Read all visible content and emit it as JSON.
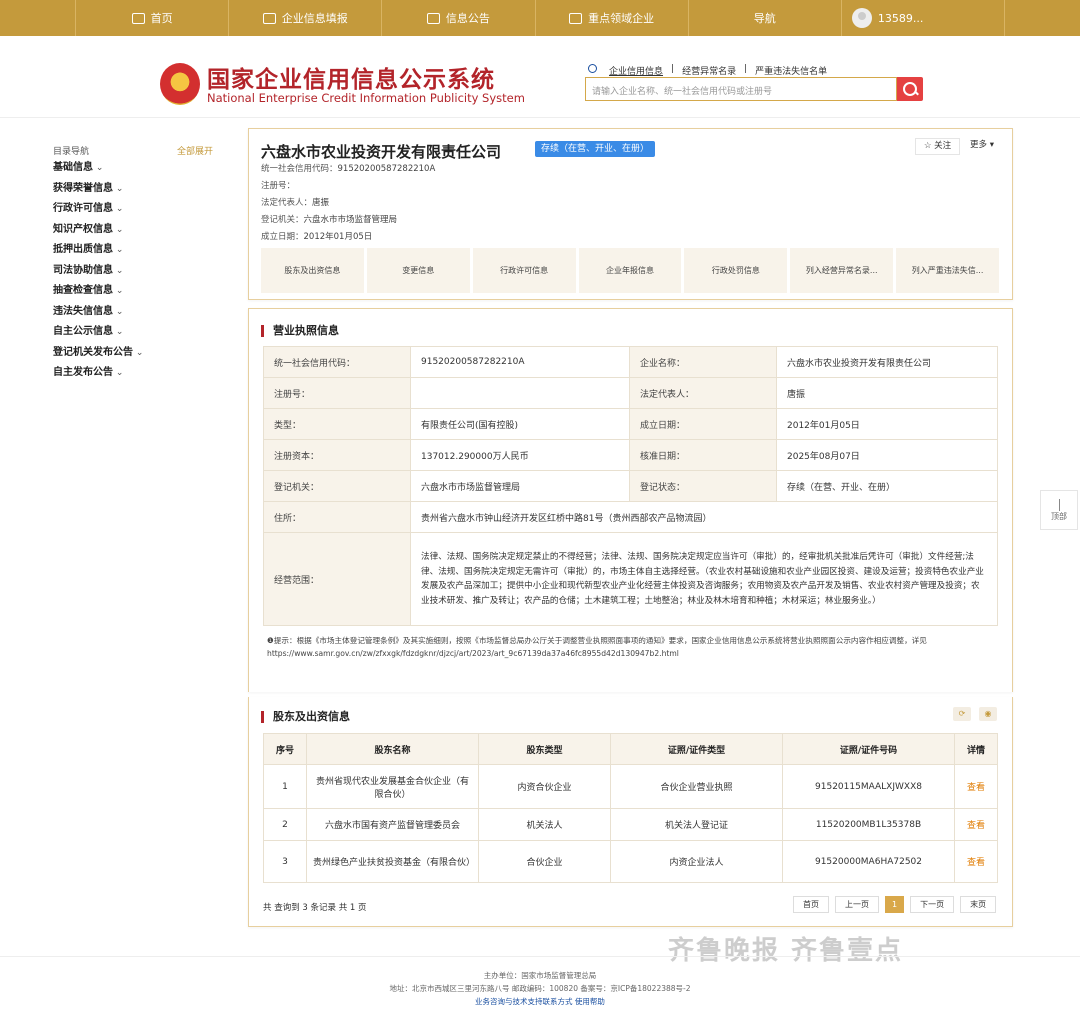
{
  "topnav": {
    "items": [
      "首页",
      "企业信息填报",
      "信息公告",
      "重点领域企业",
      "导航"
    ],
    "user": "13589..."
  },
  "header": {
    "title_cn": "国家企业信用信息公示系统",
    "title_en": "National Enterprise Credit Information Publicity System",
    "search_tabs": [
      "企业信用信息",
      "经营异常名录",
      "严重违法失信名单"
    ],
    "search_placeholder": "请输入企业名称、统一社会信用代码或注册号"
  },
  "leftnav": {
    "title": "目录导航",
    "expand_all": "全部展开",
    "items": [
      "基础信息",
      "获得荣誉信息",
      "行政许可信息",
      "知识产权信息",
      "抵押出质信息",
      "司法协助信息",
      "抽查检查信息",
      "违法失信信息",
      "自主公示信息",
      "登记机关发布公告",
      "自主发布公告"
    ]
  },
  "company": {
    "name": "六盘水市农业投资开发有限责任公司",
    "status": "存续（在营、开业、在册）",
    "follow": "关注",
    "more": "更多",
    "fields": [
      {
        "label": "统一社会信用代码：",
        "value": "91520200587282210A"
      },
      {
        "label": "注册号：",
        "value": ""
      },
      {
        "label": "法定代表人：",
        "value": "唐振"
      },
      {
        "label": "登记机关：",
        "value": "六盘水市市场监督管理局"
      },
      {
        "label": "成立日期：",
        "value": "2012年01月05日"
      }
    ],
    "tabs": [
      "股东及出资信息",
      "变更信息",
      "行政许可信息",
      "企业年报信息",
      "行政处罚信息",
      "列入经营异常名录...",
      "列入严重违法失信..."
    ]
  },
  "license": {
    "title": "营业执照信息",
    "rows": [
      {
        "k1": "统一社会信用代码：",
        "v1": "91520200587282210A",
        "k2": "企业名称：",
        "v2": "六盘水市农业投资开发有限责任公司"
      },
      {
        "k1": "注册号：",
        "v1": "",
        "k2": "法定代表人：",
        "v2": "唐振"
      },
      {
        "k1": "类型：",
        "v1": "有限责任公司(国有控股)",
        "k2": "成立日期：",
        "v2": "2012年01月05日"
      },
      {
        "k1": "注册资本：",
        "v1": "137012.290000万人民币",
        "k2": "核准日期：",
        "v2": "2025年08月07日"
      },
      {
        "k1": "登记机关：",
        "v1": "六盘水市市场监督管理局",
        "k2": "登记状态：",
        "v2": "存续（在营、开业、在册）"
      }
    ],
    "address_label": "住所：",
    "address": "贵州省六盘水市钟山经济开发区红桥中路81号（贵州西部农产品物流园）",
    "scope_label": "经营范围：",
    "scope": "法律、法规、国务院决定规定禁止的不得经营；法律、法规、国务院决定规定应当许可（审批）的，经审批机关批准后凭许可（审批）文件经营;法律、法规、国务院决定规定无需许可（审批）的，市场主体自主选择经营。（农业农村基础设施和农业产业园区投资、建设及运营；投资特色农业产业发展及农产品深加工；提供中小企业和现代新型农业产业化经营主体投资及咨询服务；农用物资及农产品开发及销售、农业农村资产管理及投资；农业技术研发、推广及转让；农产品的仓储；土木建筑工程；土地整治；林业及林木培育和种植；木材采运；林业服务业。）",
    "notice": "❶提示：根据《市场主体登记管理条例》及其实施细则，按照《市场监督总局办公厅关于调整营业执照照面事项的通知》要求，国家企业信用信息公示系统将营业执照照面公示内容作相应调整，详见https://www.samr.gov.cn/zw/zfxxgk/fdzdgknr/djzcj/art/2023/art_9c67139da37a46fc8955d42d130947b2.html"
  },
  "shareholders": {
    "title": "股东及出资信息",
    "headers": [
      "序号",
      "股东名称",
      "股东类型",
      "证照/证件类型",
      "证照/证件号码",
      "详情"
    ],
    "rows": [
      {
        "no": "1",
        "name": "贵州省现代农业发展基金合伙企业（有限合伙）",
        "type": "内资合伙企业",
        "cert_type": "合伙企业营业执照",
        "cert_no": "91520115MAALXJWXX8",
        "detail": "查看"
      },
      {
        "no": "2",
        "name": "六盘水市国有资产监督管理委员会",
        "type": "机关法人",
        "cert_type": "机关法人登记证",
        "cert_no": "11520200MB1L35378B",
        "detail": "查看"
      },
      {
        "no": "3",
        "name": "贵州绿色产业扶贫投资基金（有限合伙）",
        "type": "合伙企业",
        "cert_type": "内资企业法人",
        "cert_no": "91520000MA6HA72502",
        "detail": "查看"
      }
    ],
    "count_text": "共 查询到 3 条记录 共 1 页",
    "pager": [
      "首页",
      "上一页",
      "1",
      "下一页",
      "末页"
    ]
  },
  "totop": "顶部",
  "watermark": "齐鲁晚报 齐鲁壹点",
  "footer": {
    "line1": "主办单位：国家市场监督管理总局",
    "line2": "地址：北京市西城区三里河东路八号   邮政编码：100820   备案号：京ICP备18022388号-2",
    "line3": "业务咨询与技术支持联系方式    使用帮助"
  }
}
